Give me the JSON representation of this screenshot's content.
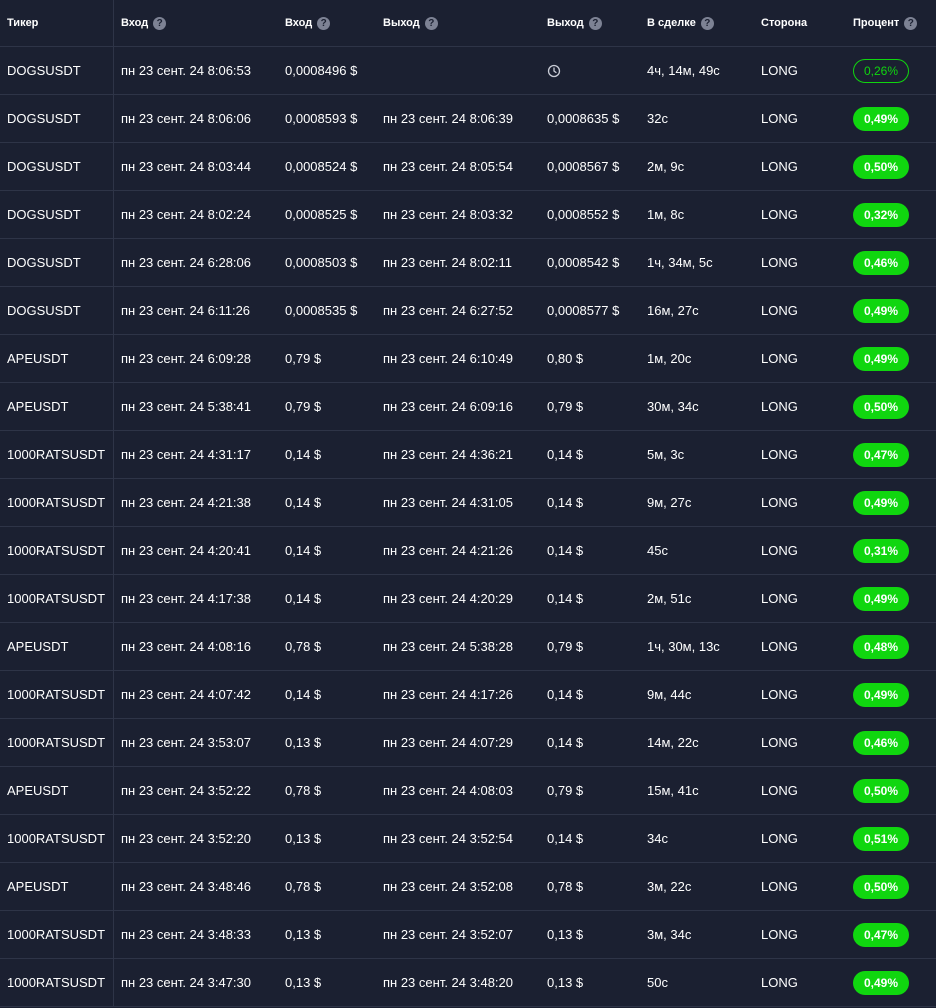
{
  "headers": {
    "ticker": "Тикер",
    "entry_time": "Вход",
    "entry_price": "Вход",
    "exit_time": "Выход",
    "exit_price": "Выход",
    "duration": "В сделке",
    "side": "Сторона",
    "percent": "Процент",
    "help_glyph": "?"
  },
  "colors": {
    "accent_green": "#10d60f",
    "background": "#1b2031",
    "divider": "#2e3447"
  },
  "rows": [
    {
      "ticker": "DOGSUSDT",
      "entry_time": "пн 23 сент. 24 8:06:53",
      "entry_price": "0,0008496 $",
      "exit_time": "",
      "exit_price": "",
      "exit_icon": "clock-icon",
      "duration": "4ч, 14м, 49с",
      "side": "LONG",
      "percent": "0,26%",
      "open": true
    },
    {
      "ticker": "DOGSUSDT",
      "entry_time": "пн 23 сент. 24 8:06:06",
      "entry_price": "0,0008593 $",
      "exit_time": "пн 23 сент. 24 8:06:39",
      "exit_price": "0,0008635 $",
      "duration": "32с",
      "side": "LONG",
      "percent": "0,49%"
    },
    {
      "ticker": "DOGSUSDT",
      "entry_time": "пн 23 сент. 24 8:03:44",
      "entry_price": "0,0008524 $",
      "exit_time": "пн 23 сент. 24 8:05:54",
      "exit_price": "0,0008567 $",
      "duration": "2м, 9с",
      "side": "LONG",
      "percent": "0,50%"
    },
    {
      "ticker": "DOGSUSDT",
      "entry_time": "пн 23 сент. 24 8:02:24",
      "entry_price": "0,0008525 $",
      "exit_time": "пн 23 сент. 24 8:03:32",
      "exit_price": "0,0008552 $",
      "duration": "1м, 8с",
      "side": "LONG",
      "percent": "0,32%"
    },
    {
      "ticker": "DOGSUSDT",
      "entry_time": "пн 23 сент. 24 6:28:06",
      "entry_price": "0,0008503 $",
      "exit_time": "пн 23 сент. 24 8:02:11",
      "exit_price": "0,0008542 $",
      "duration": "1ч, 34м, 5с",
      "side": "LONG",
      "percent": "0,46%"
    },
    {
      "ticker": "DOGSUSDT",
      "entry_time": "пн 23 сент. 24 6:11:26",
      "entry_price": "0,0008535 $",
      "exit_time": "пн 23 сент. 24 6:27:52",
      "exit_price": "0,0008577 $",
      "duration": "16м, 27с",
      "side": "LONG",
      "percent": "0,49%"
    },
    {
      "ticker": "APEUSDT",
      "entry_time": "пн 23 сент. 24 6:09:28",
      "entry_price": "0,79 $",
      "exit_time": "пн 23 сент. 24 6:10:49",
      "exit_price": "0,80 $",
      "duration": "1м, 20с",
      "side": "LONG",
      "percent": "0,49%"
    },
    {
      "ticker": "APEUSDT",
      "entry_time": "пн 23 сент. 24 5:38:41",
      "entry_price": "0,79 $",
      "exit_time": "пн 23 сент. 24 6:09:16",
      "exit_price": "0,79 $",
      "duration": "30м, 34с",
      "side": "LONG",
      "percent": "0,50%"
    },
    {
      "ticker": "1000RATSUSDT",
      "entry_time": "пн 23 сент. 24 4:31:17",
      "entry_price": "0,14 $",
      "exit_time": "пн 23 сент. 24 4:36:21",
      "exit_price": "0,14 $",
      "duration": "5м, 3с",
      "side": "LONG",
      "percent": "0,47%"
    },
    {
      "ticker": "1000RATSUSDT",
      "entry_time": "пн 23 сент. 24 4:21:38",
      "entry_price": "0,14 $",
      "exit_time": "пн 23 сент. 24 4:31:05",
      "exit_price": "0,14 $",
      "duration": "9м, 27с",
      "side": "LONG",
      "percent": "0,49%"
    },
    {
      "ticker": "1000RATSUSDT",
      "entry_time": "пн 23 сент. 24 4:20:41",
      "entry_price": "0,14 $",
      "exit_time": "пн 23 сент. 24 4:21:26",
      "exit_price": "0,14 $",
      "duration": "45с",
      "side": "LONG",
      "percent": "0,31%"
    },
    {
      "ticker": "1000RATSUSDT",
      "entry_time": "пн 23 сент. 24 4:17:38",
      "entry_price": "0,14 $",
      "exit_time": "пн 23 сент. 24 4:20:29",
      "exit_price": "0,14 $",
      "duration": "2м, 51с",
      "side": "LONG",
      "percent": "0,49%"
    },
    {
      "ticker": "APEUSDT",
      "entry_time": "пн 23 сент. 24 4:08:16",
      "entry_price": "0,78 $",
      "exit_time": "пн 23 сент. 24 5:38:28",
      "exit_price": "0,79 $",
      "duration": "1ч, 30м, 13с",
      "side": "LONG",
      "percent": "0,48%"
    },
    {
      "ticker": "1000RATSUSDT",
      "entry_time": "пн 23 сент. 24 4:07:42",
      "entry_price": "0,14 $",
      "exit_time": "пн 23 сент. 24 4:17:26",
      "exit_price": "0,14 $",
      "duration": "9м, 44с",
      "side": "LONG",
      "percent": "0,49%"
    },
    {
      "ticker": "1000RATSUSDT",
      "entry_time": "пн 23 сент. 24 3:53:07",
      "entry_price": "0,13 $",
      "exit_time": "пн 23 сент. 24 4:07:29",
      "exit_price": "0,14 $",
      "duration": "14м, 22с",
      "side": "LONG",
      "percent": "0,46%"
    },
    {
      "ticker": "APEUSDT",
      "entry_time": "пн 23 сент. 24 3:52:22",
      "entry_price": "0,78 $",
      "exit_time": "пн 23 сент. 24 4:08:03",
      "exit_price": "0,79 $",
      "duration": "15м, 41с",
      "side": "LONG",
      "percent": "0,50%"
    },
    {
      "ticker": "1000RATSUSDT",
      "entry_time": "пн 23 сент. 24 3:52:20",
      "entry_price": "0,13 $",
      "exit_time": "пн 23 сент. 24 3:52:54",
      "exit_price": "0,14 $",
      "duration": "34с",
      "side": "LONG",
      "percent": "0,51%"
    },
    {
      "ticker": "APEUSDT",
      "entry_time": "пн 23 сент. 24 3:48:46",
      "entry_price": "0,78 $",
      "exit_time": "пн 23 сент. 24 3:52:08",
      "exit_price": "0,78 $",
      "duration": "3м, 22с",
      "side": "LONG",
      "percent": "0,50%"
    },
    {
      "ticker": "1000RATSUSDT",
      "entry_time": "пн 23 сент. 24 3:48:33",
      "entry_price": "0,13 $",
      "exit_time": "пн 23 сент. 24 3:52:07",
      "exit_price": "0,13 $",
      "duration": "3м, 34с",
      "side": "LONG",
      "percent": "0,47%"
    },
    {
      "ticker": "1000RATSUSDT",
      "entry_time": "пн 23 сент. 24 3:47:30",
      "entry_price": "0,13 $",
      "exit_time": "пн 23 сент. 24 3:48:20",
      "exit_price": "0,13 $",
      "duration": "50с",
      "side": "LONG",
      "percent": "0,49%"
    }
  ]
}
